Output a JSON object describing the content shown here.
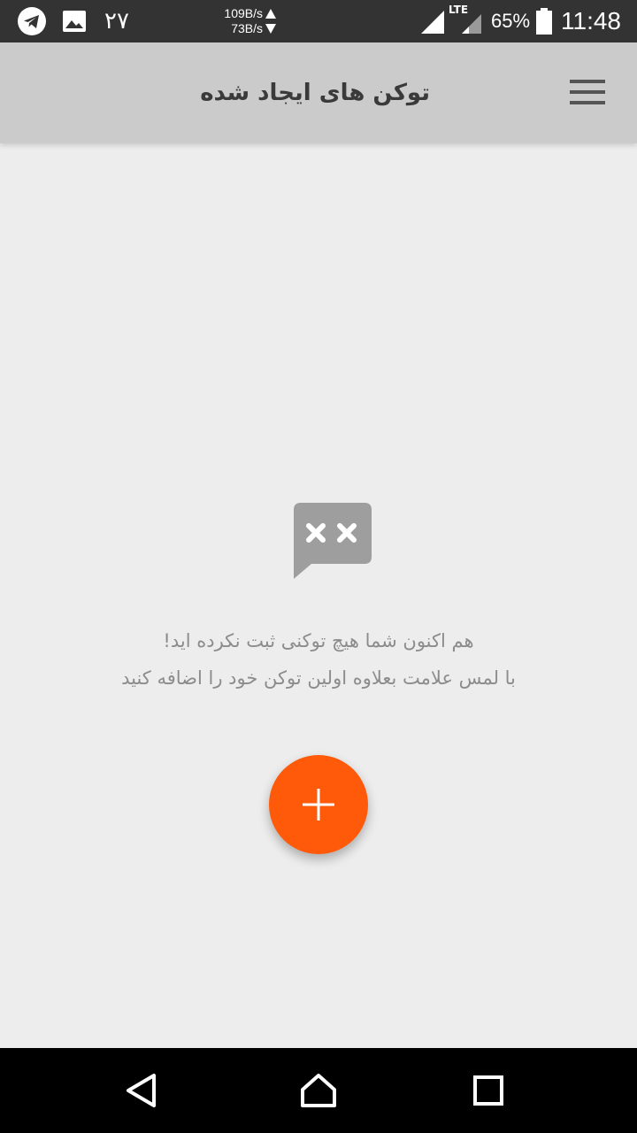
{
  "status_bar": {
    "notification_count": "۲۷",
    "upload_speed": "109B/s",
    "download_speed": "73B/s",
    "network_type": "LTE",
    "battery_percent": "65%",
    "time": "11:48",
    "icons": [
      "telegram-icon",
      "gallery-icon",
      "signal-icon",
      "battery-icon"
    ]
  },
  "app_bar": {
    "title": "توکن های ایجاد شده",
    "menu_icon": "hamburger-menu-icon"
  },
  "empty_state": {
    "icon": "empty-chat-icon",
    "line1": "هم اکنون شما هیچ توکنی ثبت نکرده اید!",
    "line2": "با لمس علامت بعلاوه اولین توکن خود را اضافه کنید"
  },
  "fab": {
    "icon": "plus-icon",
    "color": "#ff5a09"
  },
  "navigation_bar": {
    "buttons": [
      "back-icon",
      "home-icon",
      "recents-icon"
    ]
  },
  "colors": {
    "status_bar": "#333333",
    "app_bar": "#cbcbcb",
    "background": "#ededed",
    "accent": "#ff5a09",
    "nav_bar": "#000000"
  }
}
